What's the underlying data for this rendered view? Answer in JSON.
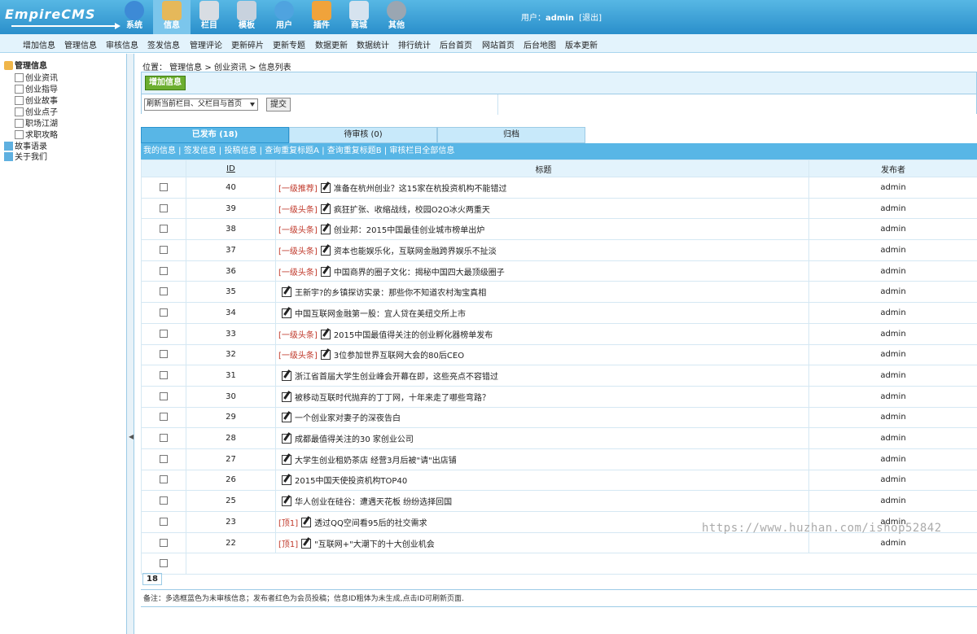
{
  "header": {
    "logo": "EmpireCMS",
    "nav": [
      {
        "label": "系统",
        "icon": "globe-icon",
        "color": "#3d8ad6"
      },
      {
        "label": "信息",
        "icon": "edit-document-icon",
        "color": "#e5b85a"
      },
      {
        "label": "栏目",
        "icon": "folder-icon",
        "color": "#d8dde3"
      },
      {
        "label": "模板",
        "icon": "template-window-icon",
        "color": "#c8d2de"
      },
      {
        "label": "用户",
        "icon": "user-icon",
        "color": "#4fa3df"
      },
      {
        "label": "插件",
        "icon": "tools-icon",
        "color": "#f0a33b"
      },
      {
        "label": "商城",
        "icon": "shop-image-icon",
        "color": "#d6e3ef"
      },
      {
        "label": "其他",
        "icon": "gear-icon",
        "color": "#9aa6b2"
      }
    ],
    "user_label": "用户：",
    "user_name": "admin",
    "logout": "[退出]"
  },
  "submenu": [
    "增加信息",
    "管理信息",
    "审核信息",
    "签发信息",
    "管理评论",
    "更新碎片",
    "更新专题",
    "数据更新",
    "数据统计",
    "排行统计",
    "后台首页",
    "网站首页",
    "后台地图",
    "版本更新"
  ],
  "sidebar": {
    "root": "管理信息",
    "items": [
      "创业资讯",
      "创业指导",
      "创业故事",
      "创业点子",
      "职场江湖",
      "求职攻略"
    ],
    "folders": [
      "故事语录",
      "关于我们"
    ]
  },
  "main": {
    "breadcrumb": "位置： 管理信息 > 创业资讯 > 信息列表",
    "add_button": "增加信息",
    "refresh_select": "刷新当前栏目、父栏目与首页",
    "submit": "提交",
    "tabs": [
      "已发布 (18)",
      "待审核 (0)",
      "归档"
    ],
    "links": "我的信息 | 签发信息 | 投稿信息 | 查询重复标题A | 查询重复标题B | 审核栏目全部信息",
    "columns": {
      "id": "ID",
      "title": "标题",
      "author": "发布者"
    },
    "rows": [
      {
        "id": "40",
        "tag": "[一级推荐]",
        "title": "准备在杭州创业？这15家在杭投资机构不能错过",
        "author": "admin"
      },
      {
        "id": "39",
        "tag": "[一级头条]",
        "title": "疯狂扩张、收缩战线，校园O2O冰火两重天",
        "author": "admin"
      },
      {
        "id": "38",
        "tag": "[一级头条]",
        "title": "创业邦：2015中国最佳创业城市榜单出炉",
        "author": "admin"
      },
      {
        "id": "37",
        "tag": "[一级头条]",
        "title": "资本也能娱乐化，互联网金融跨界娱乐不扯淡",
        "author": "admin"
      },
      {
        "id": "36",
        "tag": "[一级头条]",
        "title": "中国商界的圈子文化：揭秘中国四大最顶级圈子",
        "author": "admin"
      },
      {
        "id": "35",
        "tag": "",
        "title": "王新宇?的乡镇探访实录：那些你不知道农村淘宝真相",
        "author": "admin"
      },
      {
        "id": "34",
        "tag": "",
        "title": "中国互联网金融第一股：宜人贷在美纽交所上市",
        "author": "admin"
      },
      {
        "id": "33",
        "tag": "[一级头条]",
        "title": "2015中国最值得关注的创业孵化器榜单发布",
        "author": "admin"
      },
      {
        "id": "32",
        "tag": "[一级头条]",
        "title": "3位参加世界互联网大会的80后CEO",
        "author": "admin"
      },
      {
        "id": "31",
        "tag": "",
        "title": "浙江省首届大学生创业峰会开幕在即，这些亮点不容错过",
        "author": "admin"
      },
      {
        "id": "30",
        "tag": "",
        "title": "被移动互联时代抛弃的丁丁网，十年来走了哪些弯路？",
        "author": "admin"
      },
      {
        "id": "29",
        "tag": "",
        "title": "一个创业家对妻子的深夜告白",
        "author": "admin"
      },
      {
        "id": "28",
        "tag": "",
        "title": "成都最值得关注的30 家创业公司",
        "author": "admin"
      },
      {
        "id": "27",
        "tag": "",
        "title": "大学生创业租奶茶店 经营3月后被\"请\"出店铺",
        "author": "admin"
      },
      {
        "id": "26",
        "tag": "",
        "title": "2015中国天使投资机构TOP40",
        "author": "admin"
      },
      {
        "id": "25",
        "tag": "",
        "title": "华人创业在硅谷：遭遇天花板 纷纷选择回国",
        "author": "admin"
      },
      {
        "id": "23",
        "tag": "[顶1]",
        "title": "透过QQ空间看95后的社交需求",
        "author": "admin"
      },
      {
        "id": "22",
        "tag": "[顶1]",
        "title": "\"互联网+\"大潮下的十大创业机会",
        "author": "admin"
      }
    ],
    "count": "18",
    "footnote": "备注：多选框蓝色为未审核信息；发布者红色为会员投稿；信息ID粗体为未生成,点击ID可刷新页面."
  },
  "watermark": "https://www.huzhan.com/ishop52842"
}
